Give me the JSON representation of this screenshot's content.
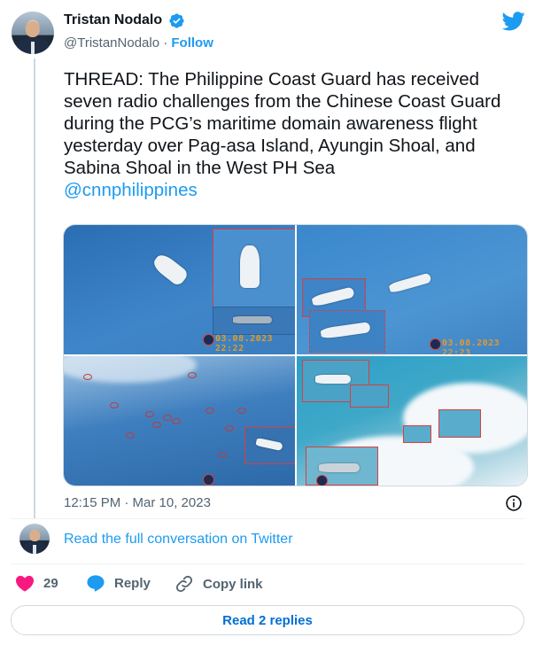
{
  "author": {
    "name": "Tristan Nodalo",
    "handle": "@TristanNodalo",
    "separator": "·",
    "follow_label": "Follow"
  },
  "tweet": {
    "text": "THREAD: The Philippine Coast Guard has received seven radio challenges from the Chinese Coast Guard during the PCG’s maritime domain awareness flight yesterday over Pag-asa Island, Ayungin Shoal, and Sabina Shoal in the West PH Sea",
    "mention": "@cnnphilippines",
    "timestamp": "12:15 PM · Mar 10, 2023"
  },
  "media": {
    "stamps": [
      "03.08.2023 22:22",
      "03.08.2023 22:23"
    ]
  },
  "conversation_link": "Read the full conversation on Twitter",
  "actions": {
    "likes_count": "29",
    "reply_label": "Reply",
    "copy_link_label": "Copy link"
  },
  "replies_button": "Read 2 replies",
  "colors": {
    "link": "#1d9bf0",
    "heart": "#f91880",
    "secondary_text": "#536471"
  },
  "icons": [
    "twitter-bird-icon",
    "verified-badge-icon",
    "info-icon",
    "heart-icon",
    "reply-bubble-icon",
    "link-icon"
  ]
}
